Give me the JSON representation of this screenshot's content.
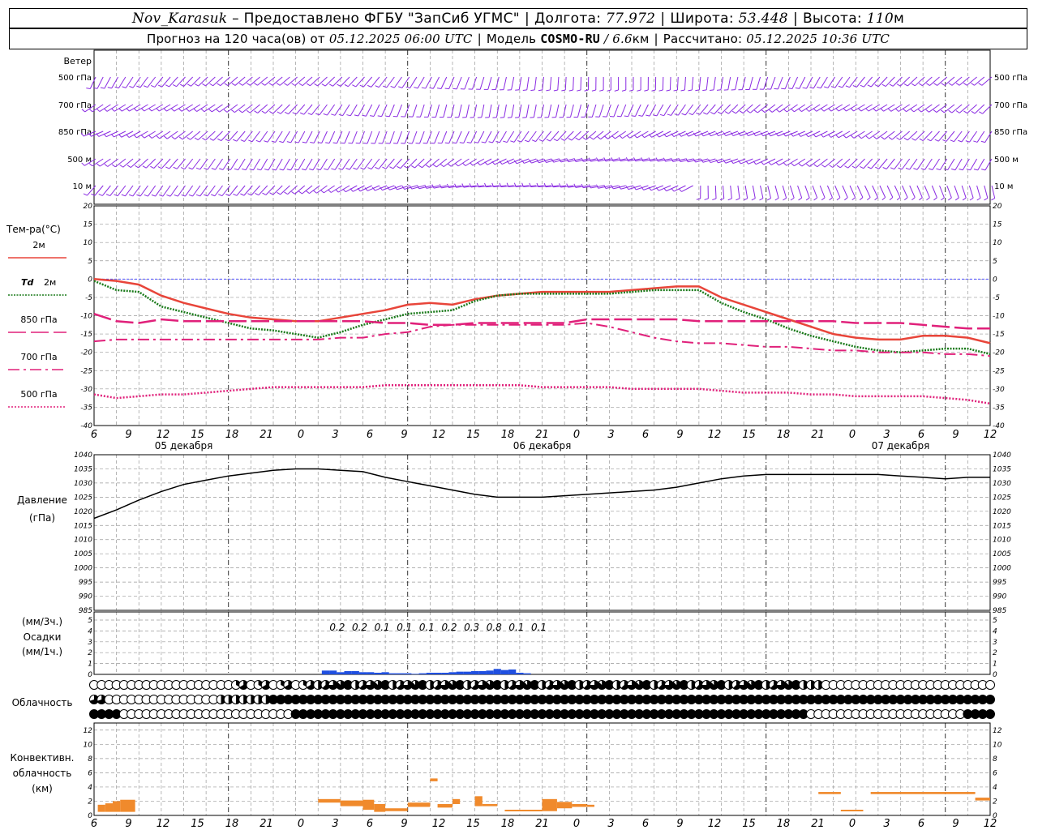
{
  "header": {
    "station": "Nov_Karasuk",
    "provider": "– Предоставлено ФГБУ \"ЗапСиб УГМС\"",
    "lon_label": "Долгота:",
    "lon_value": "77.972",
    "lat_label": "Широта:",
    "lat_value": "53.448",
    "alt_label": "Высота:",
    "alt_value": "110",
    "alt_unit": "м",
    "forecast_prefix": "Прогноз на 120 часа(ов) от",
    "forecast_start": "05.12.2025 06:00 UTC",
    "model_label": "Модель",
    "model_name": "COSMO-RU",
    "model_res": "/ 6.6",
    "model_res_unit": "км",
    "calc_label": "Рассчитано:",
    "calc_time": "05.12.2025 10:36 UTC"
  },
  "time_axis": {
    "hour_labels": [
      "6",
      "9",
      "12",
      "15",
      "18",
      "21",
      "0",
      "3",
      "6",
      "9",
      "12",
      "15",
      "18",
      "21",
      "0",
      "3",
      "6",
      "9",
      "12",
      "15",
      "18",
      "21",
      "0",
      "3",
      "6",
      "9",
      "12"
    ],
    "day_labels": [
      "05 декабря",
      "06 декабря",
      "07 декабря"
    ]
  },
  "panels": {
    "wind": {
      "title": "Ветер",
      "levels": [
        "500 гПа",
        "700 гПа",
        "850 гПа",
        "500 м",
        "10  м"
      ]
    },
    "temperature": {
      "title": "Тем-ра(°С)",
      "legend": [
        {
          "label": "2м",
          "color": "#e8453a",
          "dash": "solid"
        },
        {
          "label_it": "Td",
          "label": "2м",
          "color": "#1a7a1a",
          "dash": "dots"
        },
        {
          "label": "850 гПа",
          "color": "#e0207a",
          "dash": "long"
        },
        {
          "label": "700 гПа",
          "color": "#e0207a",
          "dash": "dashdot"
        },
        {
          "label": "500 гПа",
          "color": "#e0207a",
          "dash": "fine"
        }
      ],
      "yticks": [
        "20",
        "15",
        "10",
        "5",
        "0",
        "-5",
        "-10",
        "-15",
        "-20",
        "-25",
        "-30",
        "-35",
        "-40"
      ]
    },
    "pressure": {
      "title": "Давление",
      "unit": "(гПа)",
      "yticks": [
        "1040",
        "1035",
        "1030",
        "1025",
        "1020",
        "1015",
        "1010",
        "1005",
        "1000",
        "995",
        "990",
        "985"
      ]
    },
    "precip": {
      "title1": "(мм/3ч.)",
      "title2": "Осадки",
      "title3": "(мм/1ч.)",
      "yticks": [
        "5",
        "4",
        "3",
        "2",
        "1",
        "0"
      ],
      "labels": [
        "0.2",
        "0.2",
        "0.1",
        "0.1",
        "0.1",
        "0.2",
        "0.3",
        "0.8",
        "0.1",
        "0.1"
      ]
    },
    "cloud": {
      "title": "Облачность"
    },
    "convective": {
      "title1": "Конвективн.",
      "title2": "облачность",
      "title3": "(км)",
      "yticks": [
        "12",
        "10",
        "8",
        "6",
        "4",
        "2",
        "0"
      ]
    }
  },
  "colors": {
    "wind": "#8a2be2",
    "t2m": "#e8453a",
    "td2m": "#1a7a1a",
    "upper": "#e0207a",
    "pressure": "#000000",
    "precip": "#1f4fe0",
    "convective": "#f08a2c",
    "zero_line": "#3a3aff"
  },
  "chart_data": [
    {
      "type": "line",
      "name": "Temperature",
      "x_hours": [
        0,
        3,
        6,
        9,
        12,
        15,
        18,
        21,
        24,
        27,
        30,
        33,
        36,
        39,
        42,
        45,
        48,
        51,
        54,
        57,
        60,
        63,
        66,
        69,
        72,
        75,
        78,
        81,
        84,
        87,
        90,
        93,
        96,
        99,
        102,
        105,
        108,
        111,
        114,
        117,
        120
      ],
      "ylim": [
        -40,
        20
      ],
      "series": [
        {
          "name": "2м",
          "values": [
            0,
            -0.5,
            -1.5,
            -4.5,
            -6.5,
            -8,
            -9.5,
            -10.5,
            -11,
            -11.5,
            -11.5,
            -10.5,
            -9.5,
            -8.5,
            -7,
            -6.5,
            -7,
            -5.5,
            -4.5,
            -4,
            -3.5,
            -3.5,
            -3.5,
            -3.5,
            -3,
            -2.5,
            -2,
            -2,
            -5,
            -7,
            -9,
            -11,
            -13,
            -15,
            -16,
            -16.5,
            -16.5,
            -15.5,
            -15.5,
            -16,
            -17.5
          ]
        },
        {
          "name": "Td 2м",
          "values": [
            -0.5,
            -3,
            -3.5,
            -7.5,
            -9,
            -10.5,
            -12,
            -13.5,
            -14,
            -15,
            -16,
            -14.5,
            -12.5,
            -11,
            -9.5,
            -9,
            -8.5,
            -6,
            -4.5,
            -4,
            -4,
            -4,
            -4,
            -4,
            -3.5,
            -3,
            -3,
            -3,
            -6.5,
            -9,
            -11,
            -13.5,
            -15.5,
            -17,
            -18.5,
            -19.5,
            -20,
            -19.5,
            -19,
            -19,
            -20.5
          ]
        },
        {
          "name": "850 гПа",
          "values": [
            -9.5,
            -11.5,
            -12,
            -11,
            -11.5,
            -11.5,
            -11.5,
            -11.5,
            -11.5,
            -11.5,
            -11.5,
            -11.5,
            -11.5,
            -12,
            -12,
            -12.5,
            -12.5,
            -12,
            -12,
            -12,
            -12,
            -12,
            -11,
            -11,
            -11,
            -11,
            -11,
            -11.5,
            -11.5,
            -11.5,
            -11.5,
            -11.5,
            -11.5,
            -11.5,
            -12,
            -12,
            -12,
            -12.5,
            -13,
            -13.5,
            -13.5
          ]
        },
        {
          "name": "700 гПа",
          "values": [
            -17,
            -16.5,
            -16.5,
            -16.5,
            -16.5,
            -16.5,
            -16.5,
            -16.5,
            -16.5,
            -16.5,
            -16.5,
            -16,
            -16,
            -15,
            -14.5,
            -13,
            -12.5,
            -12.5,
            -12.5,
            -12.5,
            -12.5,
            -12.5,
            -12,
            -13,
            -14.5,
            -16,
            -17,
            -17.5,
            -17.5,
            -18,
            -18.5,
            -18.5,
            -19,
            -19.5,
            -19.5,
            -20,
            -20,
            -20,
            -20.5,
            -20.5,
            -21
          ]
        },
        {
          "name": "500 гПа",
          "values": [
            -31.5,
            -32.5,
            -32,
            -31.5,
            -31.5,
            -31,
            -30.5,
            -30,
            -29.5,
            -29.5,
            -29.5,
            -29.5,
            -29.5,
            -29,
            -29,
            -29,
            -29,
            -29,
            -29,
            -29,
            -29.5,
            -29.5,
            -29.5,
            -29.5,
            -30,
            -30,
            -30,
            -30,
            -30.5,
            -31,
            -31,
            -31,
            -31.5,
            -31.5,
            -32,
            -32,
            -32,
            -32,
            -32.5,
            -33,
            -34
          ]
        }
      ]
    },
    {
      "type": "line",
      "name": "Pressure",
      "x_hours": [
        0,
        3,
        6,
        9,
        12,
        15,
        18,
        21,
        24,
        27,
        30,
        33,
        36,
        39,
        42,
        45,
        48,
        51,
        54,
        57,
        60,
        63,
        66,
        69,
        72,
        75,
        78,
        81,
        84,
        87,
        90,
        93,
        96,
        99,
        102,
        105,
        108,
        111,
        114,
        117,
        120
      ],
      "ylim": [
        985,
        1040
      ],
      "values": [
        1017.5,
        1020.5,
        1024,
        1027,
        1029.5,
        1031,
        1032.5,
        1033.5,
        1034.5,
        1035,
        1035,
        1034.5,
        1034,
        1032,
        1030.5,
        1029,
        1027.5,
        1026,
        1025,
        1025,
        1025,
        1025.5,
        1026,
        1026.5,
        1027,
        1027.5,
        1028.5,
        1030,
        1031.5,
        1032.5,
        1033,
        1033,
        1033,
        1033,
        1033,
        1033,
        1032.5,
        1032,
        1031.5,
        1032,
        1032
      ]
    },
    {
      "type": "bar",
      "name": "Precipitation",
      "x_hours": [
        31,
        32,
        33,
        34,
        35,
        36,
        37,
        38,
        39,
        40,
        41,
        42,
        43,
        44,
        45,
        46,
        47,
        48,
        49,
        50,
        51,
        52,
        53,
        54,
        55,
        56,
        57,
        58
      ],
      "ylim": [
        0,
        5
      ],
      "values": [
        0.35,
        0.35,
        0.2,
        0.3,
        0.3,
        0.2,
        0.2,
        0.15,
        0.2,
        0.1,
        0.1,
        0.1,
        0.05,
        0.1,
        0.15,
        0.15,
        0.15,
        0.2,
        0.25,
        0.25,
        0.3,
        0.3,
        0.35,
        0.5,
        0.4,
        0.45,
        0.15,
        0.1
      ]
    },
    {
      "type": "bar",
      "name": "Convective cloud",
      "ylim": [
        0,
        13
      ],
      "segments": [
        {
          "x0": 0.5,
          "x1": 1.5,
          "base": 0.5,
          "top": 1.5
        },
        {
          "x0": 1.5,
          "x1": 2.5,
          "base": 0.5,
          "top": 1.7
        },
        {
          "x0": 2.5,
          "x1": 3.5,
          "base": 0.5,
          "top": 2.0
        },
        {
          "x0": 3.5,
          "x1": 5.5,
          "base": 0.5,
          "top": 2.2
        },
        {
          "x0": 30,
          "x1": 33,
          "base": 1.8,
          "top": 2.3
        },
        {
          "x0": 33,
          "x1": 36,
          "base": 1.3,
          "top": 2.1
        },
        {
          "x0": 36,
          "x1": 37.5,
          "base": 0.8,
          "top": 2.2
        },
        {
          "x0": 37.5,
          "x1": 39,
          "base": 0.5,
          "top": 1.6
        },
        {
          "x0": 39,
          "x1": 42,
          "base": 0.6,
          "top": 1.0
        },
        {
          "x0": 42,
          "x1": 45,
          "base": 1.2,
          "top": 1.8
        },
        {
          "x0": 45,
          "x1": 46,
          "base": 4.8,
          "top": 5.2
        },
        {
          "x0": 46,
          "x1": 48,
          "base": 1.1,
          "top": 1.6
        },
        {
          "x0": 48,
          "x1": 49,
          "base": 1.6,
          "top": 2.3
        },
        {
          "x0": 51,
          "x1": 52,
          "base": 1.3,
          "top": 2.7
        },
        {
          "x0": 52,
          "x1": 54,
          "base": 1.3,
          "top": 1.6
        },
        {
          "x0": 55,
          "x1": 60,
          "base": 0.6,
          "top": 0.8
        },
        {
          "x0": 60,
          "x1": 62,
          "base": 0.6,
          "top": 2.3
        },
        {
          "x0": 62,
          "x1": 64,
          "base": 1.0,
          "top": 1.9
        },
        {
          "x0": 64,
          "x1": 66,
          "base": 1.2,
          "top": 1.6
        },
        {
          "x0": 66,
          "x1": 67,
          "base": 1.2,
          "top": 1.5
        },
        {
          "x0": 97,
          "x1": 100,
          "base": 3.0,
          "top": 3.3
        },
        {
          "x0": 100,
          "x1": 103,
          "base": 0.6,
          "top": 0.8
        },
        {
          "x0": 104,
          "x1": 118,
          "base": 3.0,
          "top": 3.3
        },
        {
          "x0": 118,
          "x1": 120,
          "base": 2.1,
          "top": 2.5
        }
      ]
    }
  ]
}
